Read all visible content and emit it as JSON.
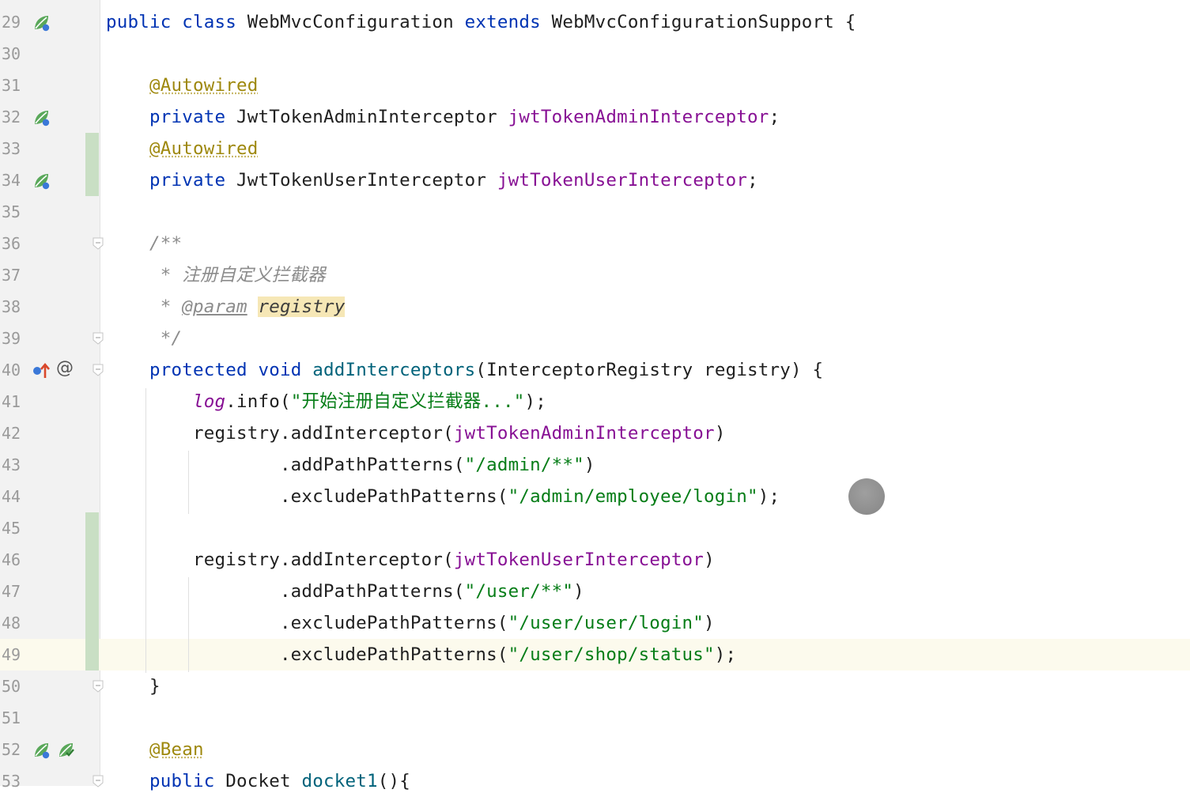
{
  "editor": {
    "lines": [
      {
        "num": "29",
        "tokens": [
          {
            "t": "public class ",
            "c": "kw"
          },
          {
            "t": "WebMvcConfiguration "
          },
          {
            "t": "extends ",
            "c": "kw"
          },
          {
            "t": "WebMvcConfigurationSupport {"
          }
        ]
      },
      {
        "num": "30",
        "tokens": []
      },
      {
        "num": "31",
        "tokens": [
          {
            "t": "    "
          },
          {
            "t": "@Autowired",
            "c": "an"
          }
        ]
      },
      {
        "num": "32",
        "tokens": [
          {
            "t": "    "
          },
          {
            "t": "private ",
            "c": "kw"
          },
          {
            "t": "JwtTokenAdminInterceptor "
          },
          {
            "t": "jwtTokenAdminInterceptor",
            "c": "fld"
          },
          {
            "t": ";"
          }
        ]
      },
      {
        "num": "33",
        "tokens": [
          {
            "t": "    "
          },
          {
            "t": "@Autowired",
            "c": "an"
          }
        ]
      },
      {
        "num": "34",
        "tokens": [
          {
            "t": "    "
          },
          {
            "t": "private ",
            "c": "kw"
          },
          {
            "t": "JwtTokenUserInterceptor "
          },
          {
            "t": "jwtTokenUserInterceptor",
            "c": "fld"
          },
          {
            "t": ";"
          }
        ]
      },
      {
        "num": "35",
        "tokens": []
      },
      {
        "num": "36",
        "tokens": [
          {
            "t": "    "
          },
          {
            "t": "/**",
            "c": "cm"
          }
        ]
      },
      {
        "num": "37",
        "tokens": [
          {
            "t": "     "
          },
          {
            "t": "* ",
            "c": "cm"
          },
          {
            "t": "注册自定义拦截器",
            "c": "cm cn"
          }
        ]
      },
      {
        "num": "38",
        "tokens": [
          {
            "t": "     "
          },
          {
            "t": "* ",
            "c": "cm"
          },
          {
            "t": "@param",
            "c": "doctag"
          },
          {
            "t": " "
          },
          {
            "t": "registry",
            "c": "hl"
          }
        ]
      },
      {
        "num": "39",
        "tokens": [
          {
            "t": "     "
          },
          {
            "t": "*/",
            "c": "cm"
          }
        ]
      },
      {
        "num": "40",
        "tokens": [
          {
            "t": "    "
          },
          {
            "t": "protected void ",
            "c": "kw"
          },
          {
            "t": "addInterceptors",
            "c": "mth"
          },
          {
            "t": "(InterceptorRegistry registry) {"
          }
        ]
      },
      {
        "num": "41",
        "tokens": [
          {
            "t": "        "
          },
          {
            "t": "log",
            "c": "log"
          },
          {
            "t": ".info("
          },
          {
            "t": "\"",
            "c": "str"
          },
          {
            "t": "开始注册自定义拦截器",
            "c": "str cn"
          },
          {
            "t": "...\"",
            "c": "str"
          },
          {
            "t": ");"
          }
        ]
      },
      {
        "num": "42",
        "tokens": [
          {
            "t": "        registry.addInterceptor("
          },
          {
            "t": "jwtTokenAdminInterceptor",
            "c": "fld"
          },
          {
            "t": ")"
          }
        ]
      },
      {
        "num": "43",
        "tokens": [
          {
            "t": "                .addPathPatterns("
          },
          {
            "t": "\"/admin/**\"",
            "c": "str"
          },
          {
            "t": ")"
          }
        ]
      },
      {
        "num": "44",
        "tokens": [
          {
            "t": "                .excludePathPatterns("
          },
          {
            "t": "\"/admin/employee/login\"",
            "c": "str"
          },
          {
            "t": ");"
          }
        ]
      },
      {
        "num": "45",
        "tokens": []
      },
      {
        "num": "46",
        "tokens": [
          {
            "t": "        registry.addInterceptor("
          },
          {
            "t": "jwtTokenUserInterceptor",
            "c": "fld"
          },
          {
            "t": ")"
          }
        ]
      },
      {
        "num": "47",
        "tokens": [
          {
            "t": "                .addPathPatterns("
          },
          {
            "t": "\"/user/**\"",
            "c": "str"
          },
          {
            "t": ")"
          }
        ]
      },
      {
        "num": "48",
        "tokens": [
          {
            "t": "                .excludePathPatterns("
          },
          {
            "t": "\"/user/user/login\"",
            "c": "str"
          },
          {
            "t": ")"
          }
        ]
      },
      {
        "num": "49",
        "tokens": [
          {
            "t": "                .excludePathPatterns("
          },
          {
            "t": "\"/user/shop/status\"",
            "c": "str"
          },
          {
            "t": ");"
          }
        ]
      },
      {
        "num": "50",
        "tokens": [
          {
            "t": "    }"
          }
        ]
      },
      {
        "num": "51",
        "tokens": []
      },
      {
        "num": "52",
        "tokens": [
          {
            "t": "    "
          },
          {
            "t": "@Bean",
            "c": "an"
          }
        ]
      },
      {
        "num": "53",
        "tokens": [
          {
            "t": "    "
          },
          {
            "t": "public ",
            "c": "kw"
          },
          {
            "t": "Docket "
          },
          {
            "t": "docket1",
            "c": "mth"
          },
          {
            "t": "(){"
          }
        ]
      }
    ]
  },
  "gutter_icons": {
    "29": [
      "spring-bean-icon"
    ],
    "32": [
      "spring-bean-icon"
    ],
    "34": [
      "spring-bean-icon"
    ],
    "40": [
      "override-up-icon",
      "at-icon"
    ],
    "52": [
      "spring-bean-icon",
      "spring-bean-check-icon"
    ]
  },
  "at_symbol": "@",
  "changed_lines": [
    "33",
    "34",
    "45",
    "46",
    "47",
    "48",
    "49"
  ],
  "fold_lines": [
    "36",
    "39",
    "40",
    "50",
    "53"
  ],
  "current_line": "49",
  "colors": {
    "keyword": "#0033b3",
    "annotation": "#9e880d",
    "field": "#871094",
    "string": "#067d17",
    "comment": "#8c8c8c",
    "method": "#00627a",
    "change_bar": "#c9dfc4",
    "gutter_bg": "#f2f2f2"
  }
}
